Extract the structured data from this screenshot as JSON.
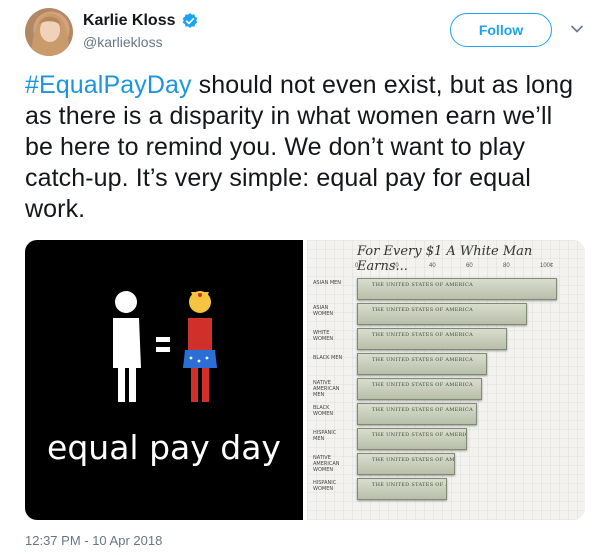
{
  "user": {
    "display_name": "Karlie Kloss",
    "handle": "@karliekloss",
    "avatar_icon": "profile-photo",
    "verified_icon": "verified-badge-icon"
  },
  "actions": {
    "follow_label": "Follow",
    "more_icon": "chevron-down-icon"
  },
  "tweet": {
    "hashtag": "#EqualPayDay",
    "body": " should not even exist, but as long as there is a disparity in what women earn we’ll be here to remind you. We don’t want to play catch-up. It’s very simple: equal pay for equal work.",
    "timestamp": "12:37 PM - 10 Apr 2018"
  },
  "media": {
    "left_caption": "equal pay day",
    "right_title": "For Every $1 A White Man Earns...",
    "tick_labels": [
      "0",
      "20",
      "40",
      "60",
      "80",
      "100¢"
    ],
    "rows": [
      {
        "label": "ASIAN MEN",
        "bill": "THE UNITED STATES OF AMERICA"
      },
      {
        "label": "ASIAN WOMEN",
        "bill": "THE UNITED STATES OF AMERICA"
      },
      {
        "label": "WHITE WOMEN",
        "bill": "THE UNITED STATES OF AMERICA"
      },
      {
        "label": "BLACK MEN",
        "bill": "THE UNITED STATES OF AMERICA"
      },
      {
        "label": "NATIVE AMERICAN MEN",
        "bill": "THE UNITED STATES OF AMERICA"
      },
      {
        "label": "BLACK WOMEN",
        "bill": "THE UNITED STATES OF AMERICA"
      },
      {
        "label": "HISPANIC MEN",
        "bill": "THE UNITED STATES OF AMERICA"
      },
      {
        "label": "NATIVE AMERICAN WOMEN",
        "bill": "THE UNITED STATES OF AMERICA"
      },
      {
        "label": "HISPANIC WOMEN",
        "bill": "THE UNITED STATES OF AMERICA"
      }
    ]
  },
  "colors": {
    "accent": "#1da1f2",
    "hashtag": "#1b95e0",
    "muted": "#657786"
  }
}
